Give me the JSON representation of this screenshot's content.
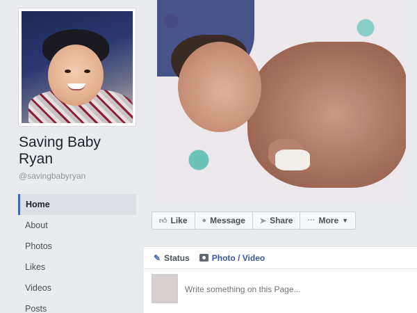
{
  "profile": {
    "name": "Saving Baby Ryan",
    "handle": "@savingbabyryan"
  },
  "nav": {
    "items": [
      {
        "label": "Home",
        "active": true
      },
      {
        "label": "About"
      },
      {
        "label": "Photos"
      },
      {
        "label": "Likes"
      },
      {
        "label": "Videos"
      },
      {
        "label": "Posts"
      }
    ]
  },
  "actions": {
    "like": "Like",
    "message": "Message",
    "share": "Share",
    "more": "More"
  },
  "composer": {
    "status_tab": "Status",
    "photo_tab": "Photo / Video",
    "placeholder": "Write something on this Page..."
  },
  "colors": {
    "accent": "#4267b2",
    "link": "#365899",
    "background": "#e9ebee"
  }
}
